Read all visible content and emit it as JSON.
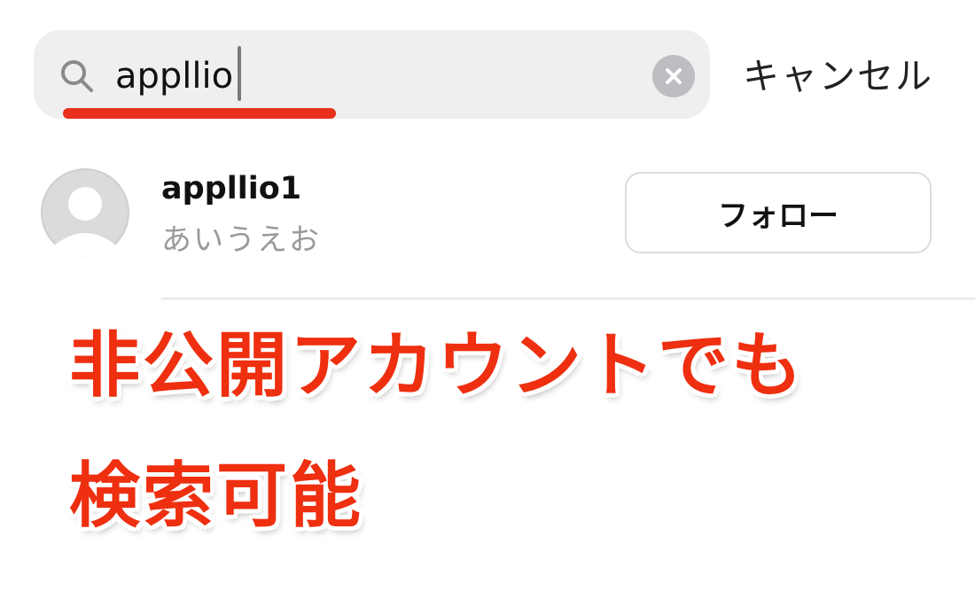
{
  "search": {
    "value": "appllio",
    "clear_icon": "clear-circle-icon",
    "cancel_label": "キャンセル"
  },
  "result": {
    "username": "appllio1",
    "display_name": "あいうえお",
    "follow_label": "フォロー"
  },
  "annotation": {
    "line1": "非公開アカウントでも",
    "line2": "検索可能"
  },
  "colors": {
    "annotation_red": "#ee2f10",
    "underline_red": "#e8301c",
    "search_bg": "#efeff0"
  }
}
